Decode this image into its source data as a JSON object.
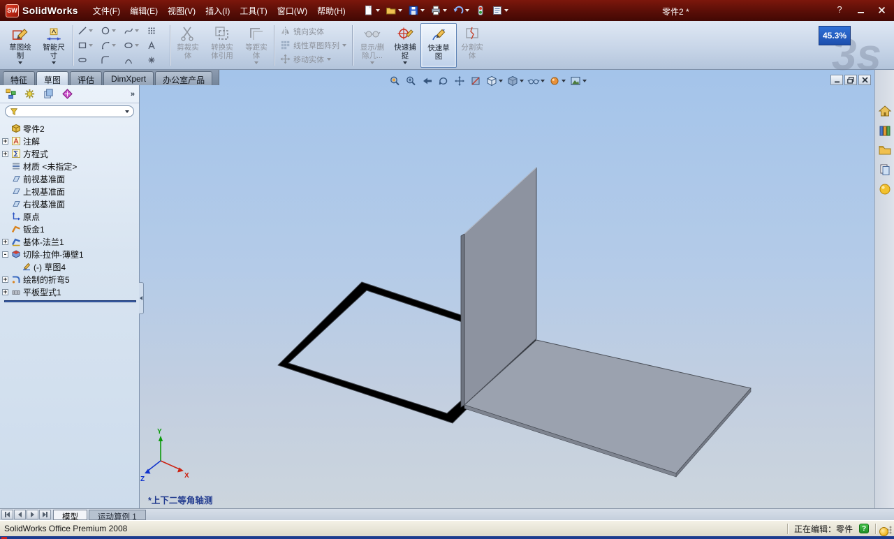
{
  "colors": {
    "titlebar": "#5a0e07",
    "ribbon_top": "#dfe8f4",
    "viewport_top": "#a4c4ea",
    "viewport_bottom": "#ccd5dd",
    "accent_blue": "#2f70d6",
    "rollback_bar": "#3a5fae"
  },
  "title_bar": {
    "logo_badge": "SW",
    "logo_text": "SolidWorks",
    "menus": [
      "文件(F)",
      "编辑(E)",
      "视图(V)",
      "插入(I)",
      "工具(T)",
      "窗口(W)",
      "帮助(H)"
    ],
    "document_title": "零件2 *",
    "help_label": "?"
  },
  "recorder": {
    "percent": "45.3%",
    "watermark": "3s"
  },
  "ribbon": {
    "sketch": {
      "line1": "草图绘",
      "line2": "制"
    },
    "smart_dimension": {
      "line1": "智能尺",
      "line2": "寸"
    },
    "trim": {
      "line1": "剪裁实",
      "line2": "体"
    },
    "convert": {
      "line1": "转换实",
      "line2": "体引用"
    },
    "offset": {
      "line1": "等距实",
      "line2": "体"
    },
    "mirror": "镜向实体",
    "linear_pattern": "线性草图阵列",
    "move": "移动实体",
    "display_delete": {
      "line1": "显示/删",
      "line2": "除几..."
    },
    "quick_snaps": {
      "line1": "快速捕",
      "line2": "捉"
    },
    "rapid_sketch": {
      "line1": "快速草",
      "line2": "图"
    },
    "split": {
      "line1": "分割实",
      "line2": "体"
    }
  },
  "command_tabs": [
    "特征",
    "草图",
    "评估",
    "DimXpert",
    "办公室产品"
  ],
  "feature_tree": {
    "more_glyph": "»",
    "filter_value": "",
    "root": "零件2",
    "items": [
      {
        "label": "注解",
        "expand": "+"
      },
      {
        "label": "方程式",
        "expand": "+"
      },
      {
        "label": "材质 <未指定>"
      },
      {
        "label": "前视基准面"
      },
      {
        "label": "上视基准面"
      },
      {
        "label": "右视基准面"
      },
      {
        "label": "原点"
      },
      {
        "label": "钣金1"
      },
      {
        "label": "基体-法兰1",
        "expand": "+"
      },
      {
        "label": "切除-拉伸-薄壁1",
        "expand": "-"
      },
      {
        "label": "(-) 草图4"
      },
      {
        "label": "绘制的折弯5",
        "expand": "+"
      },
      {
        "label": "平板型式1",
        "expand": "+"
      }
    ]
  },
  "viewport": {
    "view_label": "*上下二等角轴测",
    "axis_x": "X",
    "axis_y": "Y",
    "axis_z": "Z"
  },
  "bottom_tabs": {
    "model": "模型",
    "motion": "运动算例 1"
  },
  "status_bar": {
    "left": "SolidWorks Office Premium 2008",
    "editing": "正在编辑：零件",
    "help_glyph": "?"
  }
}
